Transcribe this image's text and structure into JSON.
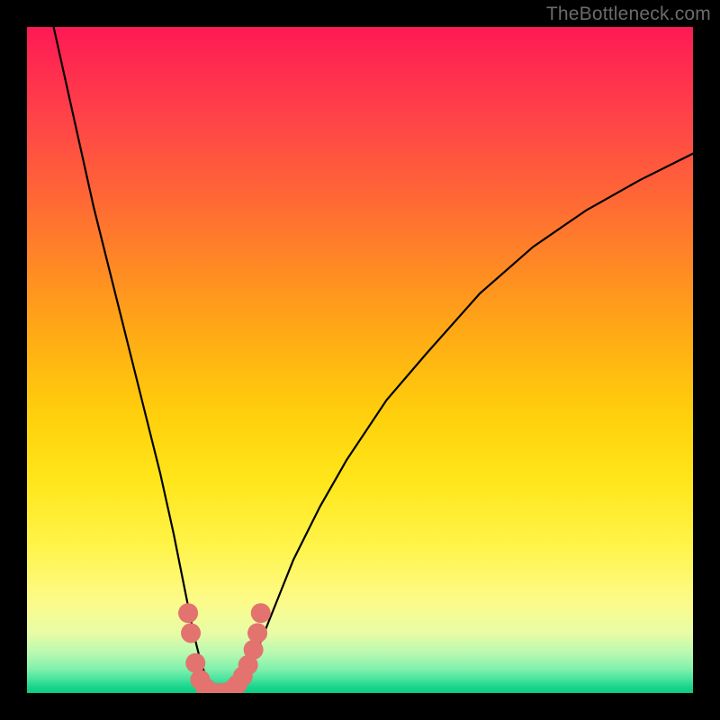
{
  "watermark": "TheBottleneck.com",
  "chart_data": {
    "type": "line",
    "title": "",
    "xlabel": "",
    "ylabel": "",
    "xlim": [
      0,
      100
    ],
    "ylim": [
      0,
      100
    ],
    "grid": false,
    "legend": false,
    "background_gradient": {
      "top": "#ff1955",
      "mid": "#ffe61a",
      "bottom": "#0ace85"
    },
    "series": [
      {
        "name": "bottleneck-curve",
        "color": "#000000",
        "x": [
          4,
          6,
          8,
          10,
          12,
          14,
          16,
          18,
          20,
          22,
          23,
          24,
          25,
          26,
          27,
          28,
          29,
          30,
          31,
          32,
          33,
          34,
          36,
          38,
          40,
          44,
          48,
          54,
          60,
          68,
          76,
          84,
          92,
          100
        ],
        "y": [
          100,
          91,
          82,
          73,
          65,
          57,
          49,
          41,
          33,
          24,
          19,
          14,
          9,
          5,
          2,
          0.3,
          0,
          0,
          0.3,
          1,
          2.5,
          5,
          10,
          15,
          20,
          28,
          35,
          44,
          51,
          60,
          67,
          72.5,
          77,
          81
        ]
      }
    ],
    "markers": {
      "name": "optimal-range",
      "color": "#e2736f",
      "points": [
        {
          "x": 24.2,
          "y": 12
        },
        {
          "x": 24.6,
          "y": 9
        },
        {
          "x": 25.3,
          "y": 4.5
        },
        {
          "x": 26.0,
          "y": 2.0
        },
        {
          "x": 26.8,
          "y": 0.8
        },
        {
          "x": 27.6,
          "y": 0.2
        },
        {
          "x": 28.4,
          "y": 0.0
        },
        {
          "x": 29.2,
          "y": 0.0
        },
        {
          "x": 30.0,
          "y": 0.1
        },
        {
          "x": 30.8,
          "y": 0.5
        },
        {
          "x": 31.6,
          "y": 1.3
        },
        {
          "x": 32.4,
          "y": 2.5
        },
        {
          "x": 33.2,
          "y": 4.2
        },
        {
          "x": 34.0,
          "y": 6.5
        },
        {
          "x": 34.6,
          "y": 9.0
        },
        {
          "x": 35.1,
          "y": 12
        }
      ]
    }
  }
}
